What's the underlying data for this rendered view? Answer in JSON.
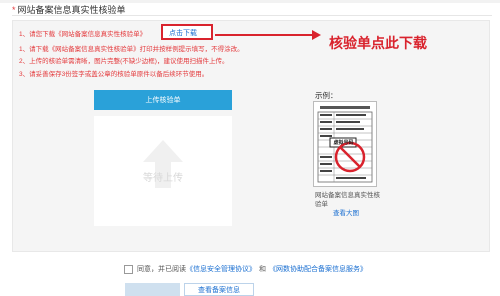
{
  "section": {
    "required_mark": "*",
    "title": "网站备案信息真实性核验单"
  },
  "steps": {
    "s1_prefix": "1、请您下载《网站备案信息真实性核验单》",
    "download_link": "点击下载",
    "s2": "1、请下载《网站备案信息真实性核验单》打印并按样例提示填写，不得涂改。",
    "s3": "2、上传的核验单需清晰，图片完整(不缺少边框)，建议使用扫描件上传。",
    "s4": "3、请妥善保存3份签字或盖公章的核验单原件以备后续环节使用。"
  },
  "annotation": "核验单点此下载",
  "upload": {
    "button_label": "上传核验单",
    "waiting_text": "等待上传"
  },
  "example": {
    "label": "示例：",
    "caption": "网站备案信息真实性核验单",
    "view_large": "查看大图",
    "stamp_text": "虚拟号码"
  },
  "agreement": {
    "prefix": "同意，并已阅读",
    "link1": "《信息安全管理协议》",
    "and": "和",
    "link2": "《网数协助配合备案信息服务》"
  },
  "buttons": {
    "view_info": "查看备案信息"
  },
  "colors": {
    "accent_red": "#d9232d",
    "step_red": "#e4393c",
    "link_blue": "#1a6fd1",
    "upload_blue": "#2aa1d9"
  }
}
